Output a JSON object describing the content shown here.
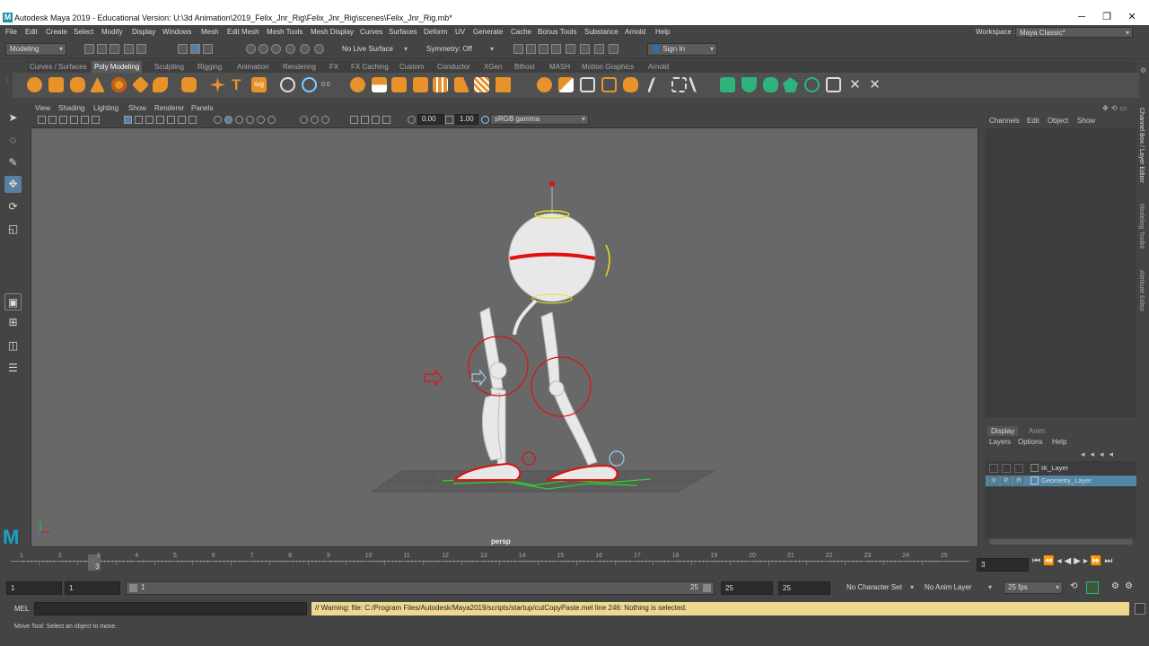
{
  "window": {
    "title": "Autodesk Maya 2019 - Educational Version: U:\\3d Animation\\2019_Felix_Jnr_Rig\\Felix_Jnr_Rig\\scenes\\Felix_Jnr_Rig.mb*",
    "logo": "M",
    "minimize": "─",
    "restore": "❐",
    "close": "✕"
  },
  "menu": [
    "File",
    "Edit",
    "Create",
    "Select",
    "Modify",
    "Display",
    "Windows",
    "Mesh",
    "Edit Mesh",
    "Mesh Tools",
    "Mesh Display",
    "Curves",
    "Surfaces",
    "Deform",
    "UV",
    "Generate",
    "Cache",
    "Bonus Tools",
    "Substance",
    "Arnold",
    "Help"
  ],
  "workspace": {
    "label": "Workspace :",
    "value": "Maya Classic*"
  },
  "status": {
    "menuset": "Modeling",
    "live_surface": "No Live Surface",
    "symmetry": "Symmetry: Off",
    "sign_in": "Sign In"
  },
  "shelf_tabs": [
    "Curves / Surfaces",
    "Poly Modeling",
    "Sculpting",
    "Rigging",
    "Animation",
    "Rendering",
    "FX",
    "FX Caching",
    "Custom",
    "Conductor",
    "XGen",
    "Bifrost",
    "MASH",
    "Motion Graphics",
    "Arnold"
  ],
  "shelf_active": "Poly Modeling",
  "viewport": {
    "menu": [
      "View",
      "Shading",
      "Lighting",
      "Show",
      "Renderer",
      "Panels"
    ],
    "exposure": "0.00",
    "gamma": "1.00",
    "colorspace": "sRGB gamma",
    "camera": "persp"
  },
  "channel_box": {
    "menu": [
      "Channels",
      "Edit",
      "Object",
      "Show"
    ]
  },
  "side_tabs": [
    "Channel Box / Layer Editor",
    "Modeling Toolkit",
    "Attribute Editor"
  ],
  "layer_editor": {
    "tabs": [
      "Display",
      "Anim"
    ],
    "menu": [
      "Layers",
      "Options",
      "Help"
    ],
    "layers": [
      {
        "name": "IK_Layer",
        "v": "",
        "p": "",
        "r": "",
        "selected": false
      },
      {
        "name": "Geometry_Layer",
        "v": "V",
        "p": "P",
        "r": "R",
        "selected": true
      }
    ]
  },
  "timeline": {
    "ticks": [
      "1",
      "2",
      "3",
      "4",
      "5",
      "6",
      "7",
      "8",
      "9",
      "10",
      "11",
      "12",
      "13",
      "14",
      "15",
      "16",
      "17",
      "18",
      "19",
      "20",
      "21",
      "22",
      "23",
      "24",
      "25"
    ],
    "current": "3",
    "current_field": "3"
  },
  "range": {
    "start": "1",
    "start2": "1",
    "slider_start": "1",
    "slider_end": "25",
    "end": "25",
    "end2": "25",
    "character_set": "No Character Set",
    "anim_layer": "No Anim Layer",
    "fps": "25 fps"
  },
  "command": {
    "lang": "MEL",
    "message": "// Warning: file: C:/Program Files/Autodesk/Maya2019/scripts/startup/cutCopyPaste.mel line 246: Nothing is selected."
  },
  "help_line": "Move Tool: Select an object to move.",
  "colors": {
    "accent": "#5285a6",
    "warning_bg": "#eed890",
    "rig_red": "#e01010",
    "control_yellow": "#e8e020",
    "ground_green": "#30d030"
  }
}
